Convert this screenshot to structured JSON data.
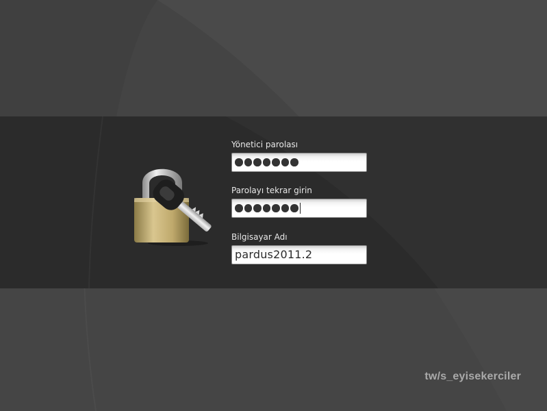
{
  "form": {
    "admin_password": {
      "label": "Yönetici parolası",
      "masked_length": 7
    },
    "confirm_password": {
      "label": "Parolayı tekrar girin",
      "masked_length": 7
    },
    "computer_name": {
      "label": "Bilgisayar Adı",
      "value": "pardus2011.2"
    }
  },
  "icons": {
    "lock": "padlock-with-key-icon"
  },
  "watermark": "tw/s_eyisekerciler",
  "colors": {
    "background": "#444444",
    "band": "#2b2b2b",
    "label_text": "#e8e8e8"
  }
}
